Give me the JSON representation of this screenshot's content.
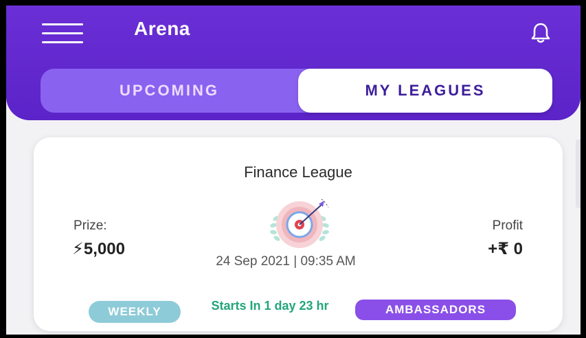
{
  "header": {
    "title": "Arena",
    "menu_icon": "hamburger-menu-icon",
    "bell_icon": "bell-icon",
    "accent_color": "#5b23c8"
  },
  "tabs": [
    {
      "label": "UPCOMING",
      "selected": false
    },
    {
      "label": "MY LEAGUES",
      "selected": true
    }
  ],
  "league_card": {
    "name": "Finance League",
    "prize_label": "Prize:",
    "prize_value": "⚡5,000",
    "profit_label": "Profit",
    "profit_value": "+₹ 0",
    "icon": "target-dartboard-icon",
    "datetime": "24 Sep 2021 | 09:35 AM",
    "frequency_badge": "WEEKLY",
    "starts_text": "Starts In 1 day 23 hr",
    "category_badge": "AMBASSADORS"
  },
  "colors": {
    "weekly_badge": "#8ecbd8",
    "starts_text": "#22a57b",
    "ambassadors_badge": "#8a4fe8"
  }
}
